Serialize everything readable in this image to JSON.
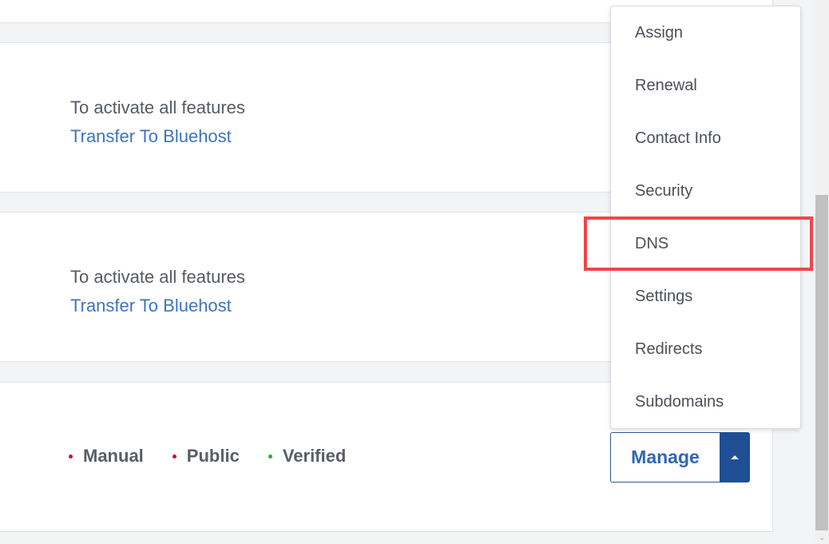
{
  "cards": [
    {
      "notice": "To activate all features",
      "link": "Transfer To Bluehost"
    },
    {
      "notice": "To activate all features",
      "link": "Transfer To Bluehost"
    }
  ],
  "status_row": {
    "items": [
      {
        "label": "Manual",
        "dot_color": "#c8102e"
      },
      {
        "label": "Public",
        "dot_color": "#c8102e"
      },
      {
        "label": "Verified",
        "dot_color": "#2ca84b"
      }
    ]
  },
  "manage": {
    "label": "Manage",
    "toggle_icon": "caret-up-icon"
  },
  "dropdown": {
    "items": [
      {
        "label": "Assign"
      },
      {
        "label": "Renewal"
      },
      {
        "label": "Contact Info"
      },
      {
        "label": "Security"
      },
      {
        "label": "DNS"
      },
      {
        "label": "Settings"
      },
      {
        "label": "Redirects"
      },
      {
        "label": "Subdomains"
      }
    ]
  },
  "highlight": {
    "target": "DNS",
    "color": "#f2444a"
  },
  "colors": {
    "link": "#3d74c0",
    "primary": "#1e4f95",
    "background": "#f2f4f6"
  }
}
